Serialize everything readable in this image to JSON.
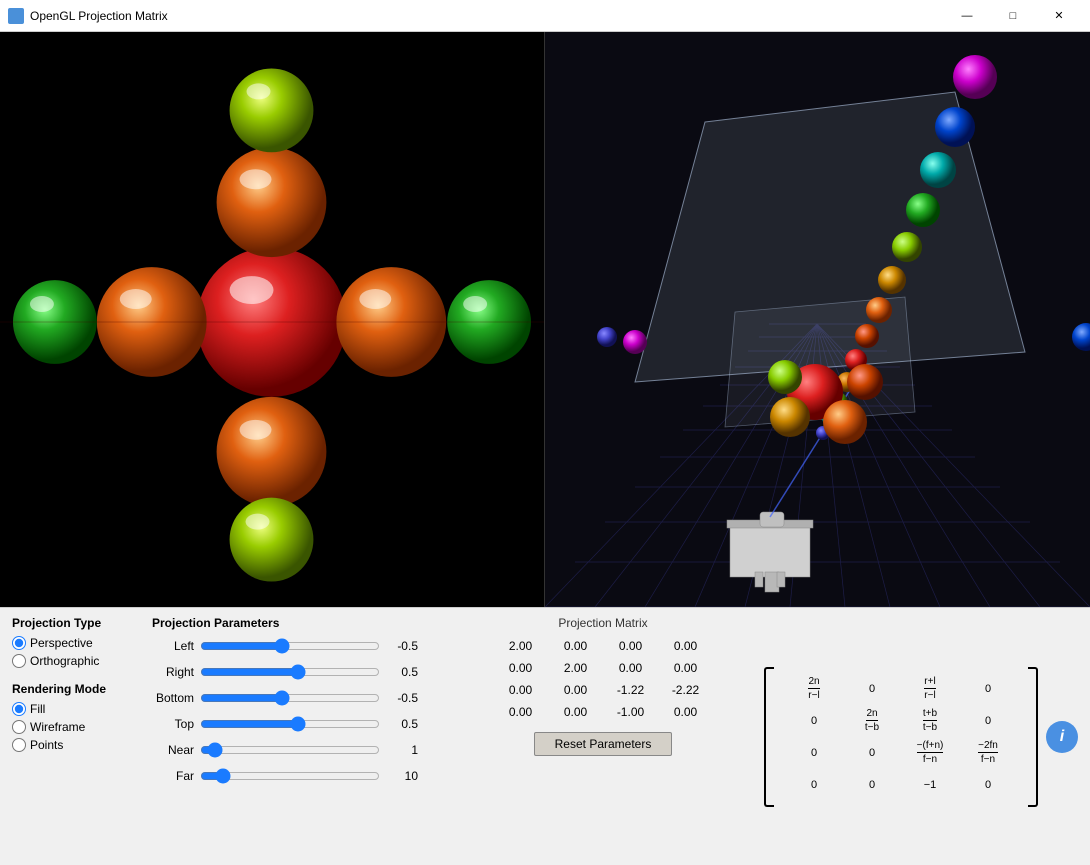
{
  "window": {
    "title": "OpenGL Projection Matrix",
    "icon": "🖥"
  },
  "titlebar": {
    "minimize_label": "—",
    "maximize_label": "□",
    "close_label": "✕"
  },
  "projection_type": {
    "section_title": "Projection Type",
    "options": [
      "Perspective",
      "Orthographic"
    ],
    "selected": "Perspective"
  },
  "rendering_mode": {
    "section_title": "Rendering Mode",
    "options": [
      "Fill",
      "Wireframe",
      "Points"
    ],
    "selected": "Fill"
  },
  "params": {
    "section_title": "Projection Parameters",
    "sliders": [
      {
        "label": "Left",
        "value": -0.5,
        "min": -5,
        "max": 5,
        "display": "-0.5"
      },
      {
        "label": "Right",
        "value": 0.5,
        "min": -5,
        "max": 5,
        "display": "0.5"
      },
      {
        "label": "Bottom",
        "value": -0.5,
        "min": -5,
        "max": 5,
        "display": "-0.5"
      },
      {
        "label": "Top",
        "value": 0.5,
        "min": -5,
        "max": 5,
        "display": "0.5"
      },
      {
        "label": "Near",
        "value": 1,
        "min": 0.1,
        "max": 20,
        "display": "1"
      },
      {
        "label": "Far",
        "value": 10,
        "min": 1,
        "max": 100,
        "display": "10"
      }
    ]
  },
  "matrix": {
    "section_title": "Projection Matrix",
    "values": [
      [
        "2.00",
        "0.00",
        "0.00",
        "0.00"
      ],
      [
        "0.00",
        "2.00",
        "0.00",
        "0.00"
      ],
      [
        "0.00",
        "0.00",
        "-1.22",
        "-2.22"
      ],
      [
        "0.00",
        "0.00",
        "-1.00",
        "0.00"
      ]
    ],
    "reset_label": "Reset Parameters"
  },
  "formula": {
    "cells": [
      [
        {
          "type": "frac",
          "num": "2n",
          "den": "r−l"
        },
        {
          "type": "zero"
        },
        {
          "type": "frac",
          "num": "r+l",
          "den": "r−l"
        },
        {
          "type": "zero"
        }
      ],
      [
        {
          "type": "zero"
        },
        {
          "type": "frac",
          "num": "2n",
          "den": "t−b"
        },
        {
          "type": "frac",
          "num": "t+b",
          "den": "t−b"
        },
        {
          "type": "zero"
        }
      ],
      [
        {
          "type": "zero"
        },
        {
          "type": "zero"
        },
        {
          "type": "frac",
          "num": "−(f+n)",
          "den": "f−n"
        },
        {
          "type": "frac",
          "num": "−2fn",
          "den": "f−n"
        }
      ],
      [
        {
          "type": "zero"
        },
        {
          "type": "zero"
        },
        {
          "type": "val",
          "val": "−1"
        },
        {
          "type": "zero"
        }
      ]
    ]
  },
  "info_button": {
    "label": "i"
  }
}
